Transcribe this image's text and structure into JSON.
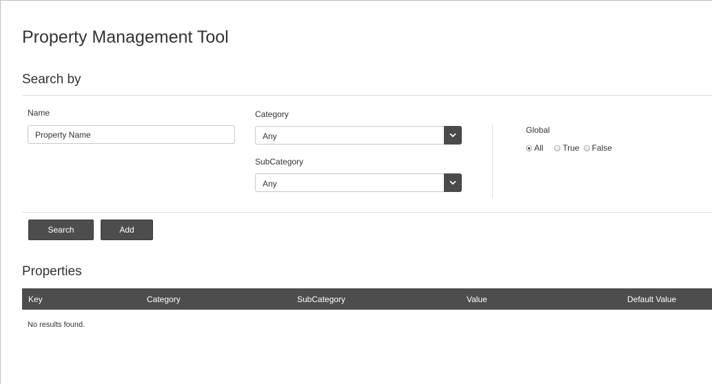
{
  "page": {
    "title": "Property Management Tool"
  },
  "search": {
    "heading": "Search by",
    "name_label": "Name",
    "name_placeholder": "Property Name",
    "category_label": "Category",
    "category_value": "Any",
    "subcategory_label": "SubCategory",
    "subcategory_value": "Any",
    "global_label": "Global",
    "global_options": [
      "All",
      "True",
      "False"
    ],
    "global_selected": "All"
  },
  "actions": {
    "search_label": "Search",
    "add_label": "Add"
  },
  "properties": {
    "heading": "Properties",
    "columns": [
      "Key",
      "Category",
      "SubCategory",
      "Value",
      "Default Value"
    ],
    "empty_message": "No results found."
  },
  "icons": {
    "dropdown": "chevron-down-icon",
    "radio": "radio-button-icon"
  },
  "colors": {
    "button_bg": "#4d4d4d",
    "header_bg": "#4d4d4d",
    "text": "#333333"
  }
}
